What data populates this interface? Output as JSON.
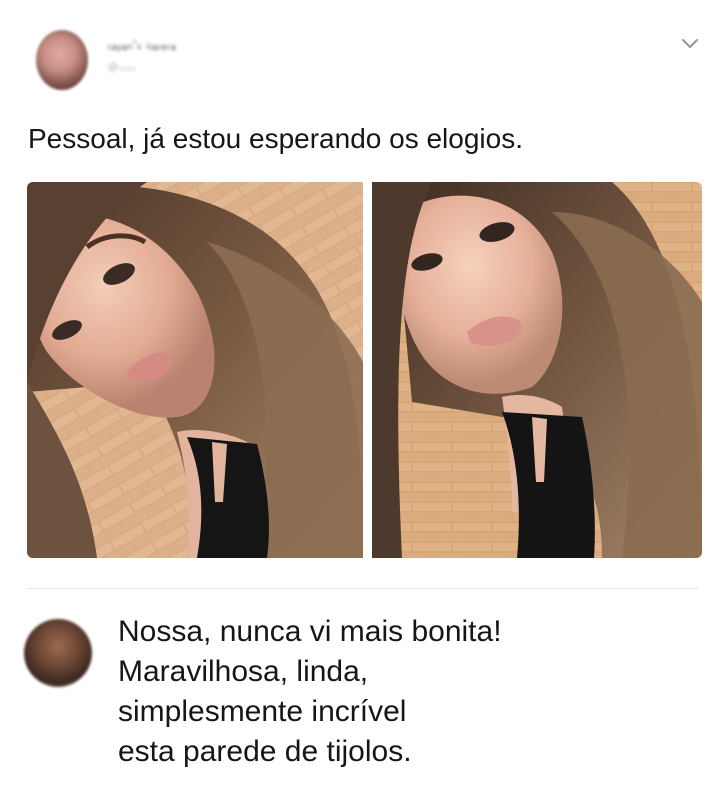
{
  "tweet": {
    "author_name": "ᵣₐᵧₐₙ'ₛ ₗᵢₐᵣₑᵣₐ",
    "author_handle": "@ₓₓₓₓ",
    "text": "Pessoal, já estou esperando os elogios.",
    "menu_icon": "chevron-down-icon",
    "photos": [
      {
        "description_icon": "selfie-photo"
      },
      {
        "description_icon": "selfie-photo"
      }
    ]
  },
  "reply": {
    "lines": [
      "Nossa, nunca vi mais bonita!",
      "Maravilhosa, linda,",
      "simplesmente incrível",
      "esta parede de tijolos."
    ]
  },
  "colors": {
    "divider": "#e1e8ed",
    "text": "#14171a",
    "brick": "#d9a878"
  }
}
